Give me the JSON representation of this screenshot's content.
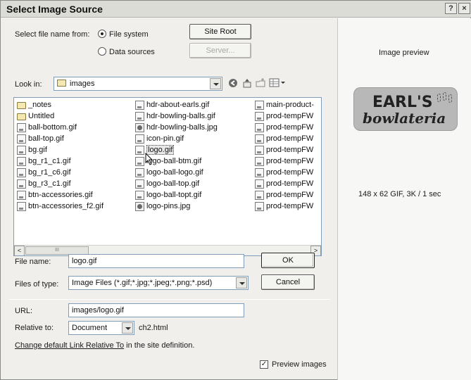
{
  "window": {
    "title": "Select Image Source",
    "help_btn": "?",
    "close_btn": "×"
  },
  "source": {
    "prompt": "Select file name from:",
    "options": [
      {
        "label": "File system",
        "selected": true
      },
      {
        "label": "Data sources",
        "selected": false
      }
    ],
    "site_root_button": "Site Root",
    "server_button": "Server..."
  },
  "lookin": {
    "label": "Look in:",
    "folder": "images",
    "toolbar_icons": [
      "back-icon",
      "up-folder-icon",
      "new-folder-icon",
      "view-menu-icon"
    ]
  },
  "files": {
    "columns": [
      [
        {
          "name": "_notes",
          "icon": "folder"
        },
        {
          "name": "Untitled",
          "icon": "folder"
        },
        {
          "name": "ball-bottom.gif",
          "icon": "doc"
        },
        {
          "name": "ball-top.gif",
          "icon": "doc"
        },
        {
          "name": "bg.gif",
          "icon": "doc"
        },
        {
          "name": "bg_r1_c1.gif",
          "icon": "doc"
        },
        {
          "name": "bg_r1_c6.gif",
          "icon": "doc"
        },
        {
          "name": "bg_r3_c1.gif",
          "icon": "doc"
        },
        {
          "name": "btn-accessories.gif",
          "icon": "doc"
        },
        {
          "name": "btn-accessories_f2.gif",
          "icon": "doc"
        }
      ],
      [
        {
          "name": "hdr-about-earls.gif",
          "icon": "doc"
        },
        {
          "name": "hdr-bowling-balls.gif",
          "icon": "doc"
        },
        {
          "name": "hdr-bowling-balls.jpg",
          "icon": "jpg"
        },
        {
          "name": "icon-pin.gif",
          "icon": "doc"
        },
        {
          "name": "logo.gif",
          "icon": "doc",
          "selected": true
        },
        {
          "name": "logo-ball-btm.gif",
          "icon": "doc"
        },
        {
          "name": "logo-ball-logo.gif",
          "icon": "doc"
        },
        {
          "name": "logo-ball-top.gif",
          "icon": "doc"
        },
        {
          "name": "logo-ball-topt.gif",
          "icon": "doc"
        },
        {
          "name": "logo-pins.jpg",
          "icon": "jpg"
        }
      ],
      [
        {
          "name": "main-product-",
          "icon": "doc"
        },
        {
          "name": "prod-tempFW",
          "icon": "doc"
        },
        {
          "name": "prod-tempFW",
          "icon": "doc"
        },
        {
          "name": "prod-tempFW",
          "icon": "doc"
        },
        {
          "name": "prod-tempFW",
          "icon": "doc"
        },
        {
          "name": "prod-tempFW",
          "icon": "doc"
        },
        {
          "name": "prod-tempFW",
          "icon": "doc"
        },
        {
          "name": "prod-tempFW",
          "icon": "doc"
        },
        {
          "name": "prod-tempFW",
          "icon": "doc"
        },
        {
          "name": "prod-tempFW",
          "icon": "doc"
        }
      ]
    ],
    "scroll_left": "<",
    "scroll_right": ">",
    "scroll_thumb": "III"
  },
  "filename": {
    "label": "File name:",
    "value": "logo.gif",
    "ok_button": "OK"
  },
  "filetype": {
    "label": "Files of type:",
    "value": "Image Files (*.gif;*.jpg;*.jpeg;*.png;*.psd)",
    "cancel_button": "Cancel"
  },
  "url": {
    "label": "URL:",
    "value": "images/logo.gif"
  },
  "relative": {
    "label": "Relative to:",
    "value": "Document",
    "file": "ch2.html"
  },
  "link": {
    "link_text": "Change default Link Relative To",
    "rest": " in the site definition."
  },
  "preview_option": {
    "label": "Preview images",
    "checked": true
  },
  "preview": {
    "title": "Image preview",
    "logo_line1": "EARL'S",
    "logo_line2": "bowlateria",
    "info": "148 x 62 GIF, 3K / 1 sec"
  }
}
